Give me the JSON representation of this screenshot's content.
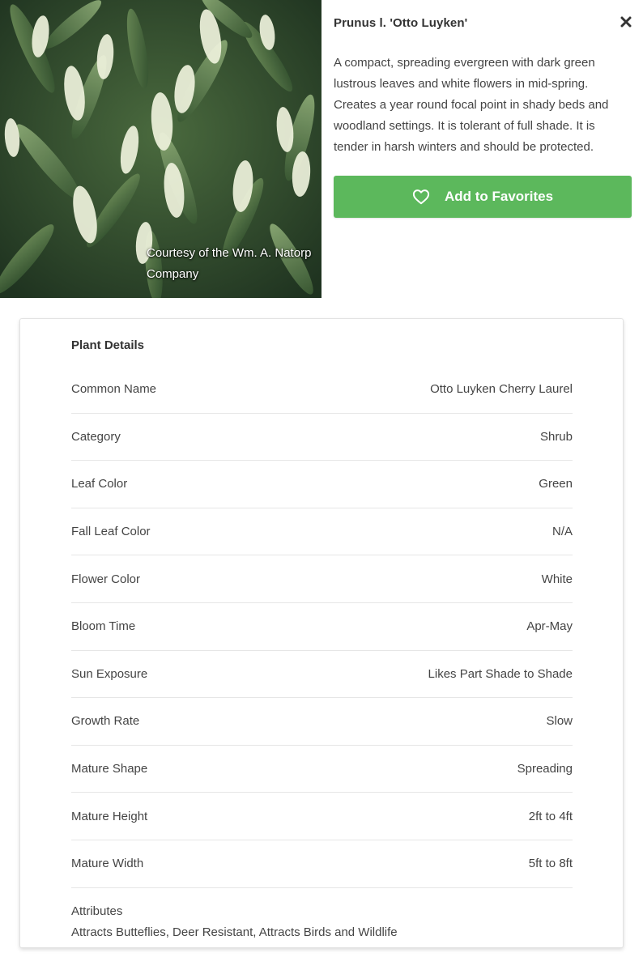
{
  "plant": {
    "title": "Prunus l. 'Otto Luyken'",
    "description": "A compact, spreading evergreen with dark green lustrous leaves and white flowers in mid-spring. Creates a year round focal point in shady beds and woodland settings. It is tolerant of full shade. It is tender in harsh winters and should be protected.",
    "photo_credit": "Courtesy of the Wm. A. Natorp Company"
  },
  "actions": {
    "add_favorites_label": "Add to Favorites",
    "favorite_icon": "heart-outline-icon",
    "close_icon": "close-x-icon"
  },
  "details": {
    "heading": "Plant Details",
    "rows": [
      {
        "label": "Common Name",
        "value": "Otto Luyken Cherry Laurel"
      },
      {
        "label": "Category",
        "value": "Shrub"
      },
      {
        "label": "Leaf Color",
        "value": "Green"
      },
      {
        "label": "Fall Leaf Color",
        "value": "N/A"
      },
      {
        "label": "Flower Color",
        "value": "White"
      },
      {
        "label": "Bloom Time",
        "value": "Apr-May"
      },
      {
        "label": "Sun Exposure",
        "value": "Likes Part Shade to Shade"
      },
      {
        "label": "Growth Rate",
        "value": "Slow"
      },
      {
        "label": "Mature Shape",
        "value": "Spreading"
      },
      {
        "label": "Mature Height",
        "value": "2ft to 4ft"
      },
      {
        "label": "Mature Width",
        "value": "5ft to 8ft"
      }
    ],
    "attributes_label": "Attributes",
    "attributes_value": "Attracts Butteflies, Deer Resistant, Attracts Birds and Wildlife"
  },
  "colors": {
    "accent_green": "#5cb85c",
    "text": "#444444",
    "divider": "#e6e6e6"
  }
}
